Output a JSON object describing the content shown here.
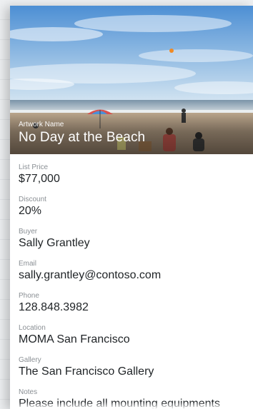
{
  "artwork": {
    "name_label": "Artwork Name",
    "name": "No Day at the Beach",
    "image_icon": "beach-photo"
  },
  "details": [
    {
      "label": "List Price",
      "value": "$77,000"
    },
    {
      "label": "Discount",
      "value": "20%"
    },
    {
      "label": "Buyer",
      "value": "Sally Grantley"
    },
    {
      "label": "Email",
      "value": "sally.grantley@contoso.com"
    },
    {
      "label": "Phone",
      "value": "128.848.3982"
    },
    {
      "label": "Location",
      "value": "MOMA San Francisco"
    },
    {
      "label": "Gallery",
      "value": "The San Francisco Gallery"
    },
    {
      "label": "Notes",
      "value": "Please include all mounting equipments"
    }
  ],
  "colors": {
    "card_background": "#ffffff",
    "label_text": "#8a8f94",
    "value_text": "#1f2326",
    "title_text": "#ffffff"
  }
}
